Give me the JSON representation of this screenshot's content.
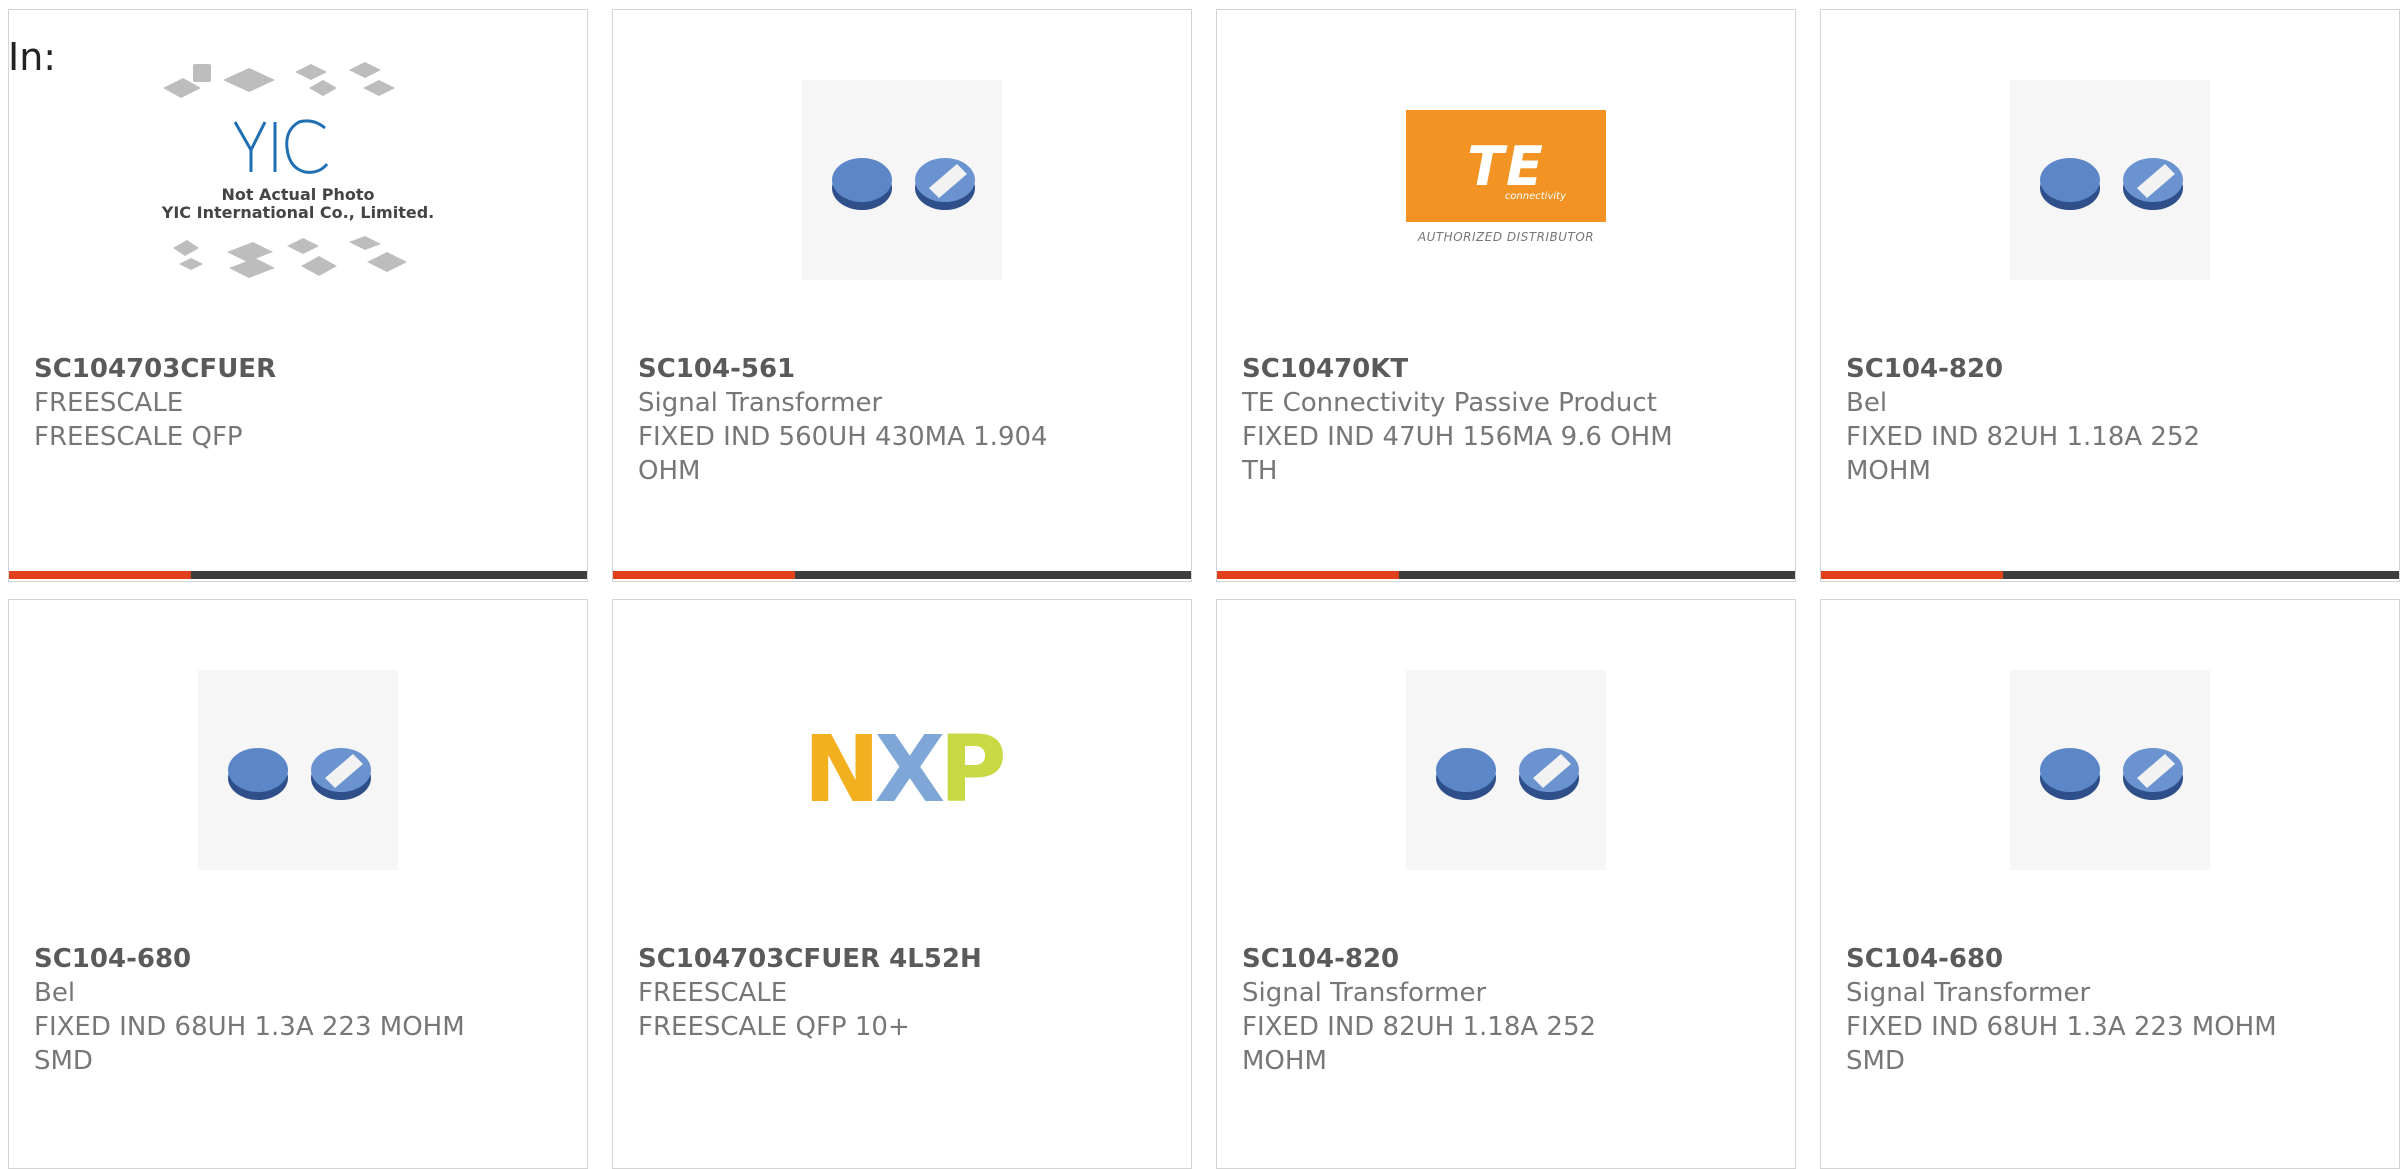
{
  "header": {
    "in_label": "In:"
  },
  "colors": {
    "accent": "#e0401c",
    "bar": "#3d3d3d",
    "te_orange": "#f39323"
  },
  "products": [
    {
      "part": "SC104703CFUER",
      "lines": [
        "FREESCALE",
        "FREESCALE QFP"
      ],
      "image": "yic-not-actual-photo",
      "yic": {
        "line1": "Not Actual Photo",
        "line2": "YIC International Co., Limited."
      }
    },
    {
      "part": "SC104-561",
      "lines": [
        "Signal Transformer",
        "FIXED IND 560UH 430MA 1.904",
        "OHM"
      ],
      "image": "inductor-photo"
    },
    {
      "part": "SC10470KT",
      "lines": [
        "TE Connectivity Passive Product",
        "FIXED IND 47UH 156MA 9.6 OHM",
        "TH"
      ],
      "image": "te-logo",
      "te": {
        "name": "TE",
        "sub": "connectivity",
        "authorized": "AUTHORIZED DISTRIBUTOR"
      }
    },
    {
      "part": "SC104-820",
      "lines": [
        "Bel",
        "FIXED IND 82UH 1.18A 252",
        "MOHM"
      ],
      "image": "inductor-photo"
    },
    {
      "part": "SC104-680",
      "lines": [
        "Bel",
        "FIXED IND 68UH 1.3A 223 MOHM",
        "SMD"
      ],
      "image": "inductor-photo"
    },
    {
      "part": "SC104703CFUER 4L52H",
      "lines": [
        "FREESCALE",
        "FREESCALE QFP 10+"
      ],
      "image": "nxp-logo",
      "nxp": {
        "n": "N",
        "x": "X",
        "p": "P"
      }
    },
    {
      "part": "SC104-820",
      "lines": [
        "Signal Transformer",
        "FIXED IND 82UH 1.18A 252",
        "MOHM"
      ],
      "image": "inductor-photo"
    },
    {
      "part": "SC104-680",
      "lines": [
        "Signal Transformer",
        "FIXED IND 68UH 1.3A 223 MOHM",
        "SMD"
      ],
      "image": "inductor-photo"
    }
  ]
}
